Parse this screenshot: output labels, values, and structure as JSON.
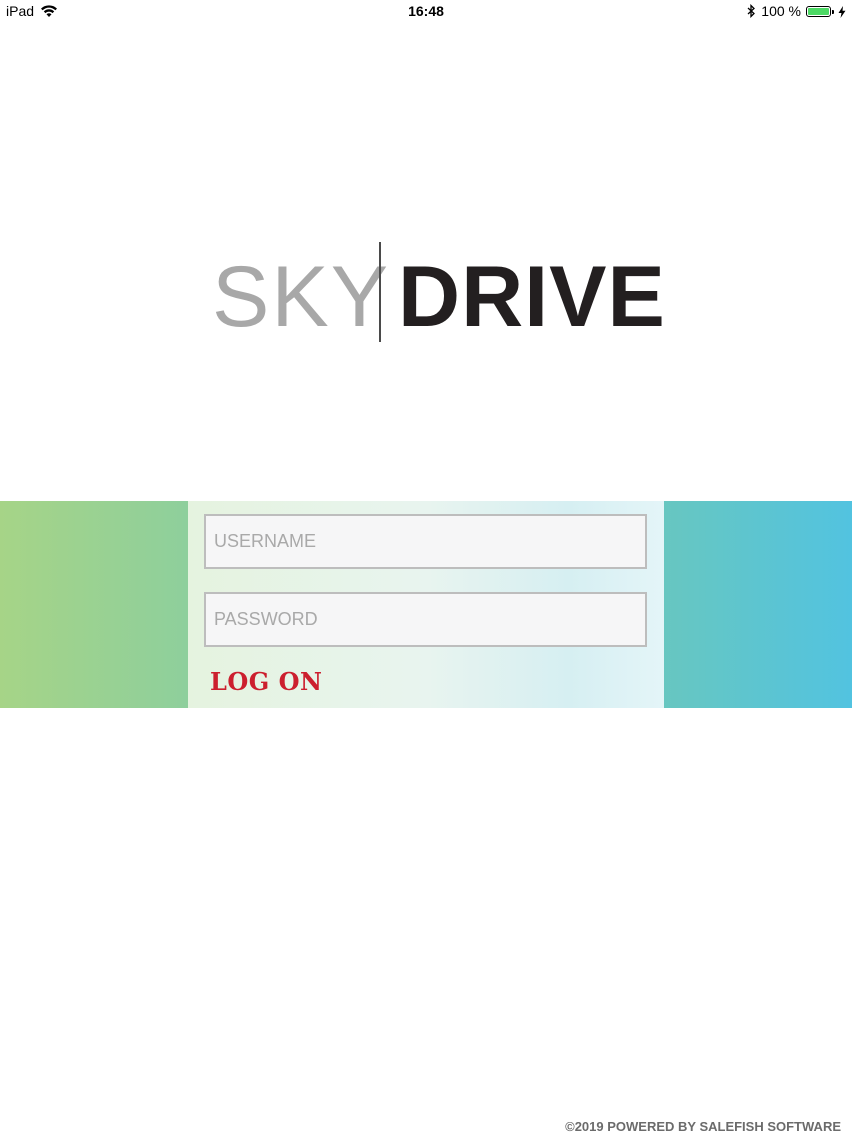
{
  "status_bar": {
    "device": "iPad",
    "time": "16:48",
    "battery_percent": "100 %",
    "battery_level": 1.0,
    "icons": [
      "wifi-icon",
      "bluetooth-icon",
      "battery-icon",
      "charging-icon"
    ]
  },
  "logo": {
    "left_word": "SKY",
    "right_word": "DRIVE"
  },
  "login": {
    "username_placeholder": "USERNAME",
    "password_placeholder": "PASSWORD",
    "logon_label": "LOG ON"
  },
  "colors": {
    "band_left": "#a6d487",
    "band_right": "#52c3e0",
    "logon_text": "#cc1f2e"
  },
  "footer": {
    "text": "©2019 POWERED BY SALEFISH SOFTWARE"
  }
}
